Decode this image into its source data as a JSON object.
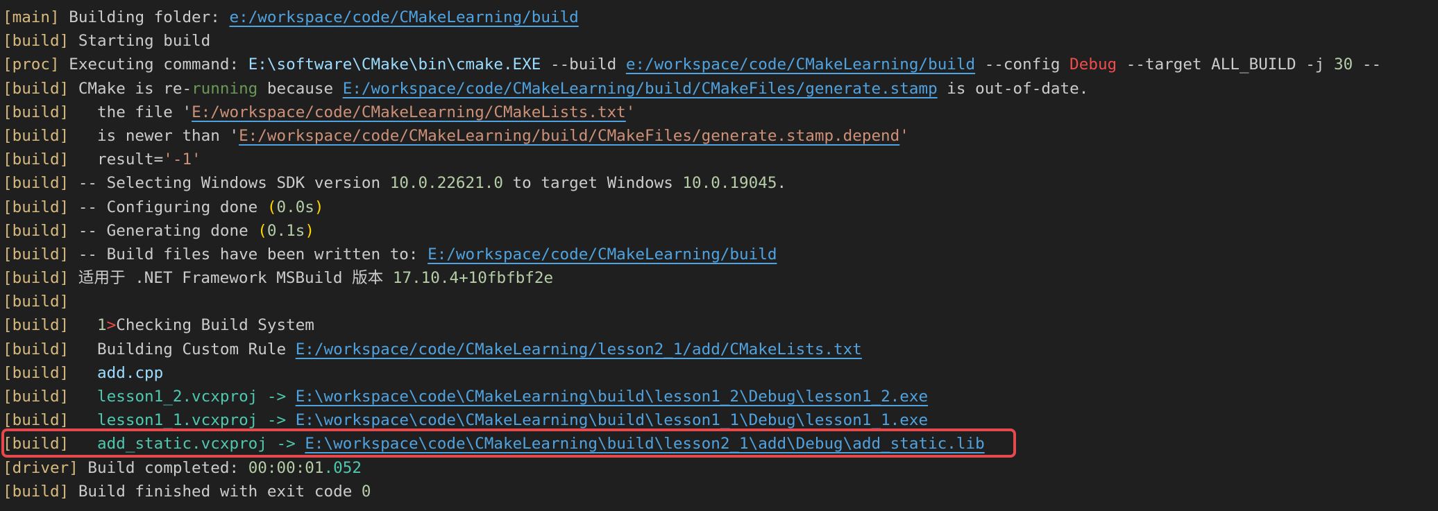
{
  "lines": [
    {
      "tag": "[main]",
      "text": " Building folder: ",
      "link": "e:/workspace/code/CMakeLearning/build"
    },
    {
      "tag": "[build]",
      "text": " Starting build"
    },
    {
      "tag": "[proc]",
      "text": " Executing command: ",
      "exe": "E:\\software\\CMake\\bin\\cmake.EXE",
      "mid": " --build ",
      "link": "e:/workspace/code/CMakeLearning/build",
      "cfg": " --config ",
      "debug": "Debug",
      "tail": " --target ALL_BUILD -j ",
      "jobs": "30",
      "end": " --"
    },
    {
      "tag": "[build]",
      "text1": " CMake is re-",
      "running": "running",
      "text2": " because ",
      "link": "E:/workspace/code/CMakeLearning/build/CMakeFiles/generate.stamp",
      "text3": " is out-of-date."
    },
    {
      "tag": "[build]",
      "text": "   the file '",
      "link": "E:/workspace/code/CMakeLearning/CMakeLists.txt",
      "end": "'"
    },
    {
      "tag": "[build]",
      "text": "   is newer than '",
      "link": "E:/workspace/code/CMakeLearning/build/CMakeFiles/generate.stamp.depend",
      "end": "'"
    },
    {
      "tag": "[build]",
      "text": "   result=",
      "val": "'-1'"
    },
    {
      "tag": "[build]",
      "text1": " -- Selecting Windows SDK version ",
      "v1": "10.0.22621.0",
      "text2": " to target Windows ",
      "v2": "10.0.19045",
      "text3": "."
    },
    {
      "tag": "[build]",
      "text": " -- Configuring done ",
      "p1": "(",
      "time": "0.0s",
      "p2": ")"
    },
    {
      "tag": "[build]",
      "text": " -- Generating done ",
      "p1": "(",
      "time": "0.1s",
      "p2": ")"
    },
    {
      "tag": "[build]",
      "text": " -- Build files have been written to: ",
      "link": "E:/workspace/code/CMakeLearning/build"
    },
    {
      "tag": "[build]",
      "text": " 适用于 .NET Framework MSBuild 版本 ",
      "ver": "17.10.4+10fbfbf2e"
    },
    {
      "tag": "[build]"
    },
    {
      "tag": "[build]",
      "indent": "   ",
      "num": "1",
      "arrow": ">",
      "text": "Checking Build System"
    },
    {
      "tag": "[build]",
      "text": "   Building Custom Rule ",
      "link": "E:/workspace/code/CMakeLearning/lesson2_1/add/CMakeLists.txt"
    },
    {
      "tag": "[build]",
      "indent": "   ",
      "file": "add.cpp"
    },
    {
      "tag": "[build]",
      "indent": "   ",
      "proj": "lesson1_2.vcxproj",
      "arrow": " -> ",
      "link": "E:\\workspace\\code\\CMakeLearning\\build\\lesson1_2\\Debug\\lesson1_2.exe"
    },
    {
      "tag": "[build]",
      "indent": "   ",
      "proj": "lesson1_1.vcxproj",
      "arrow": " -> ",
      "link": "E:\\workspace\\code\\CMakeLearning\\build\\lesson1_1\\Debug\\lesson1_1.exe"
    },
    {
      "tag": "[build]",
      "indent": "   ",
      "proj": "add_static.vcxproj",
      "arrow": " -> ",
      "link": "E:\\workspace\\code\\CMakeLearning\\build\\lesson2_1\\add\\Debug\\add_static.lib"
    },
    {
      "tag": "[driver]",
      "text": " Build completed: ",
      "t1": "00:00:01",
      "t2": ".052"
    },
    {
      "tag": "[build]",
      "text": " Build finished with exit code ",
      "code": "0"
    }
  ]
}
